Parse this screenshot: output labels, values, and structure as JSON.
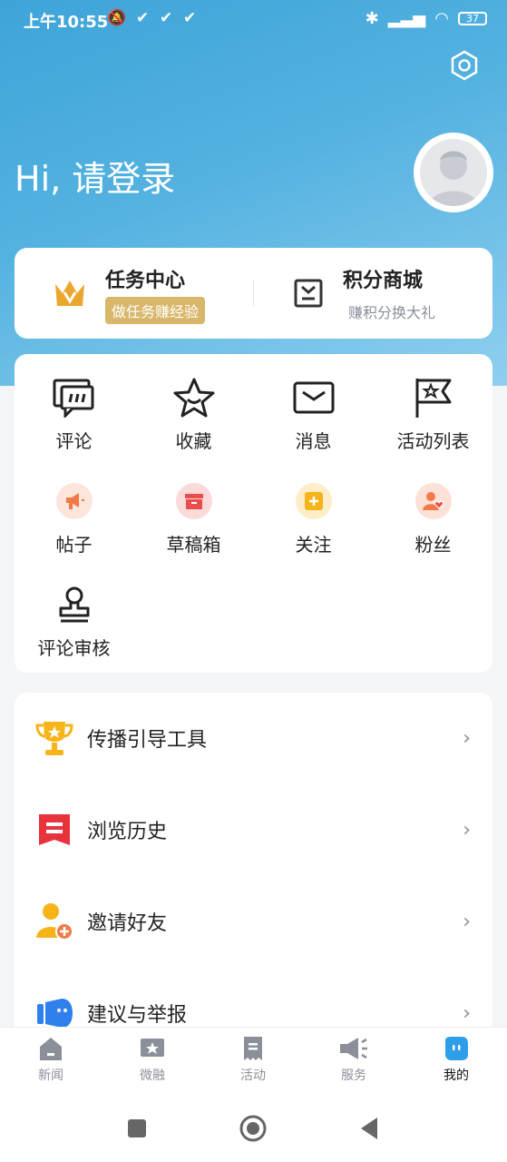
{
  "status_bar": {
    "time": "上午10:55",
    "battery": "37"
  },
  "header": {
    "greeting": "Hi, 请登录"
  },
  "quick": {
    "task": {
      "title": "任务中心",
      "tag": "做任务赚经验"
    },
    "points": {
      "title": "积分商城",
      "subtitle": "赚积分换大礼"
    }
  },
  "grid": [
    {
      "label": "评论",
      "icon": "comment-icon"
    },
    {
      "label": "收藏",
      "icon": "star-icon"
    },
    {
      "label": "消息",
      "icon": "mail-icon"
    },
    {
      "label": "活动列表",
      "icon": "flag-icon"
    },
    {
      "label": "帖子",
      "icon": "megaphone-icon",
      "color": "#f07a4a"
    },
    {
      "label": "草稿箱",
      "icon": "draft-box-icon",
      "color": "#ea4d4d"
    },
    {
      "label": "关注",
      "icon": "follow-icon",
      "color": "#f6b419"
    },
    {
      "label": "粉丝",
      "icon": "fans-icon",
      "color": "#f07a4a"
    },
    {
      "label": "评论审核",
      "icon": "stamp-icon"
    }
  ],
  "list": [
    {
      "label": "传播引导工具",
      "icon": "trophy-icon",
      "color": "#f6b419"
    },
    {
      "label": "浏览历史",
      "icon": "history-icon",
      "color": "#e8323c"
    },
    {
      "label": "邀请好友",
      "icon": "invite-user-icon",
      "color": "#f6b419"
    },
    {
      "label": "建议与举报",
      "icon": "feedback-icon",
      "color": "#2f80ed"
    }
  ],
  "tabs": [
    {
      "label": "新闻",
      "icon": "home-icon"
    },
    {
      "label": "微融",
      "icon": "star-box-icon"
    },
    {
      "label": "活动",
      "icon": "receipt-icon"
    },
    {
      "label": "服务",
      "icon": "speaker-icon"
    },
    {
      "label": "我的",
      "icon": "me-icon",
      "active": true
    }
  ],
  "colors": {
    "accent": "#3ea4d8",
    "gold": "#d9b76a",
    "active_tab": "#2f9ee8"
  }
}
